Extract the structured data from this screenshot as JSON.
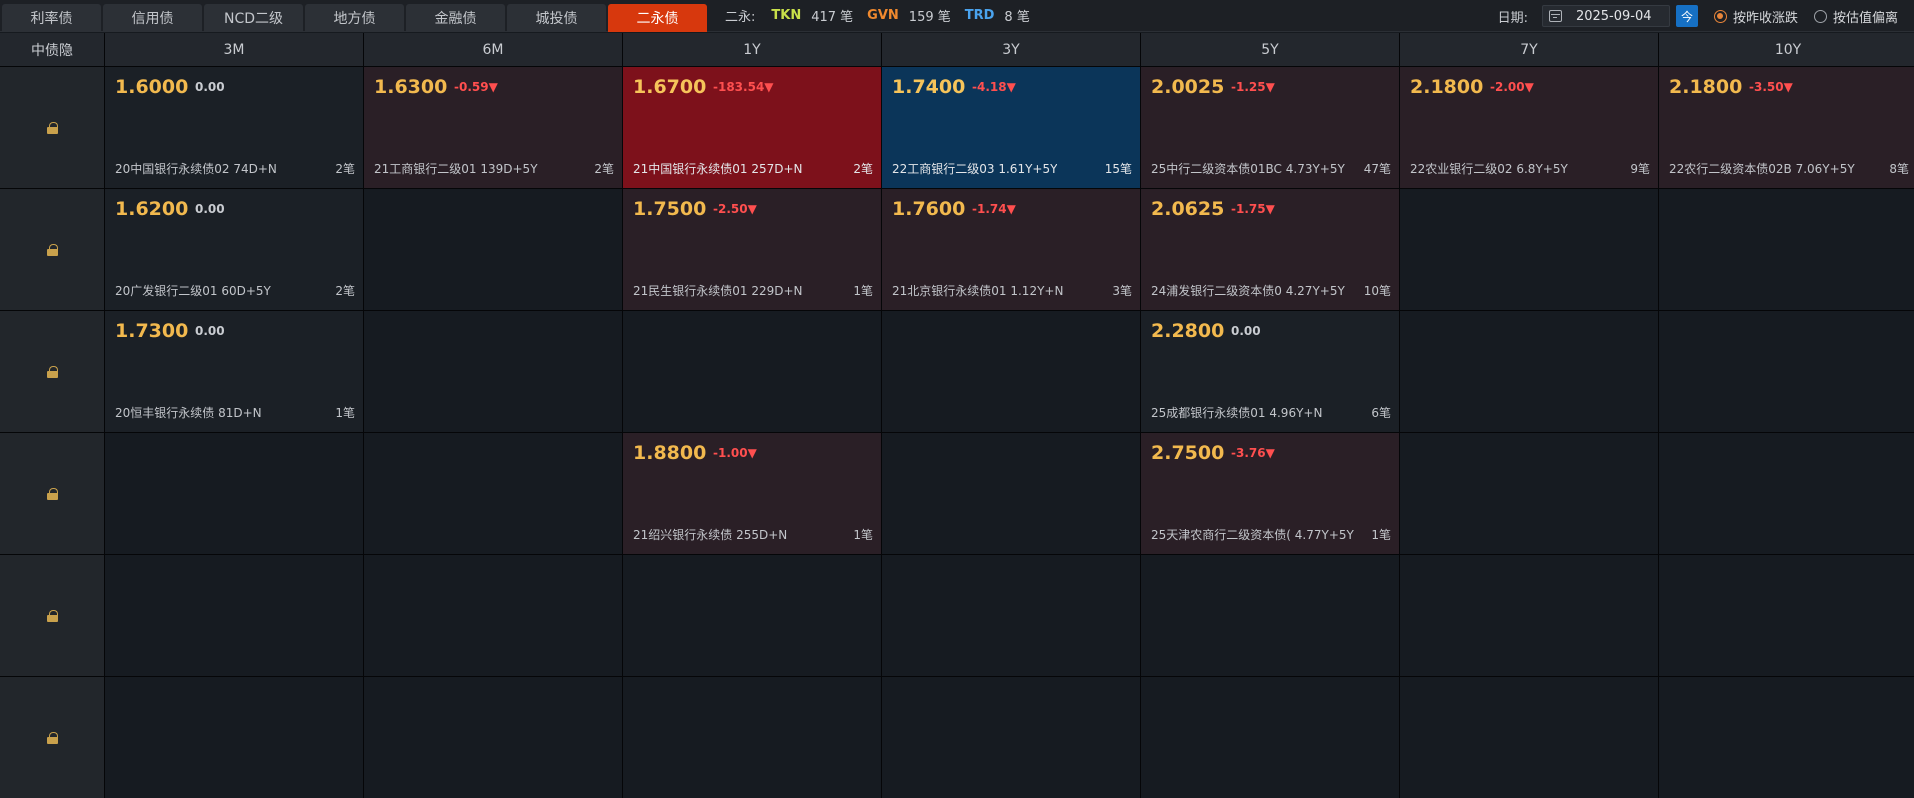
{
  "tabs": [
    {
      "label": "利率债",
      "active": false
    },
    {
      "label": "信用债",
      "active": false
    },
    {
      "label": "NCD二级",
      "active": false
    },
    {
      "label": "地方债",
      "active": false
    },
    {
      "label": "金融债",
      "active": false
    },
    {
      "label": "城投债",
      "active": false
    },
    {
      "label": "二永债",
      "active": true
    }
  ],
  "summary": {
    "label": "二永:",
    "items": [
      {
        "code": "TKN",
        "count": "417 笔",
        "color": "#c8e04a"
      },
      {
        "code": "GVN",
        "count": "159 笔",
        "color": "#f0892e"
      },
      {
        "code": "TRD",
        "count": "8 笔",
        "color": "#4aa3ee"
      }
    ]
  },
  "controls": {
    "date_label": "日期:",
    "date_value": "2025-09-04",
    "today_label": "今",
    "radio_prev_close": "按昨收涨跌",
    "radio_valuation": "按估值偏离",
    "selected": "prev_close"
  },
  "grid": {
    "corner_label": "中债隐",
    "columns": [
      "3M",
      "6M",
      "1Y",
      "3Y",
      "5Y",
      "7Y",
      "10Y"
    ],
    "rows": [
      [
        {
          "yield": "1.6000",
          "change": "0.00",
          "dir": "zero",
          "bond": "20中国银行永续债02 74D+N",
          "count": "2笔",
          "style": "q"
        },
        {
          "yield": "1.6300",
          "change": "-0.59▼",
          "dir": "down",
          "bond": "21工商银行二级01 139D+5Y",
          "count": "2笔",
          "style": "neg"
        },
        {
          "yield": "1.6700",
          "change": "-183.54▼",
          "dir": "down",
          "bond": "21中国银行永续债01 257D+N",
          "count": "2笔",
          "style": "hot"
        },
        {
          "yield": "1.7400",
          "change": "-4.18▼",
          "dir": "down",
          "bond": "22工商银行二级03 1.61Y+5Y",
          "count": "15笔",
          "style": "blue"
        },
        {
          "yield": "2.0025",
          "change": "-1.25▼",
          "dir": "down",
          "bond": "25中行二级资本债01BC 4.73Y+5Y",
          "count": "47笔",
          "style": "neg"
        },
        {
          "yield": "2.1800",
          "change": "-2.00▼",
          "dir": "down",
          "bond": "22农业银行二级02 6.8Y+5Y",
          "count": "9笔",
          "style": "neg"
        },
        {
          "yield": "2.1800",
          "change": "-3.50▼",
          "dir": "down",
          "bond": "22农行二级资本债02B 7.06Y+5Y",
          "count": "8笔",
          "style": "neg"
        }
      ],
      [
        {
          "yield": "1.6200",
          "change": "0.00",
          "dir": "zero",
          "bond": "20广发银行二级01 60D+5Y",
          "count": "2笔",
          "style": "q"
        },
        null,
        {
          "yield": "1.7500",
          "change": "-2.50▼",
          "dir": "down",
          "bond": "21民生银行永续债01 229D+N",
          "count": "1笔",
          "style": "neg"
        },
        {
          "yield": "1.7600",
          "change": "-1.74▼",
          "dir": "down",
          "bond": "21北京银行永续债01 1.12Y+N",
          "count": "3笔",
          "style": "neg"
        },
        {
          "yield": "2.0625",
          "change": "-1.75▼",
          "dir": "down",
          "bond": "24浦发银行二级资本债0 4.27Y+5Y",
          "count": "10笔",
          "style": "neg"
        },
        null,
        null
      ],
      [
        {
          "yield": "1.7300",
          "change": "0.00",
          "dir": "zero",
          "bond": "20恒丰银行永续债 81D+N",
          "count": "1笔",
          "style": "q"
        },
        null,
        null,
        null,
        {
          "yield": "2.2800",
          "change": "0.00",
          "dir": "zero",
          "bond": "25成都银行永续债01 4.96Y+N",
          "count": "6笔",
          "style": "q"
        },
        null,
        null
      ],
      [
        null,
        null,
        {
          "yield": "1.8800",
          "change": "-1.00▼",
          "dir": "down",
          "bond": "21绍兴银行永续债 255D+N",
          "count": "1笔",
          "style": "neg"
        },
        null,
        {
          "yield": "2.7500",
          "change": "-3.76▼",
          "dir": "down",
          "bond": "25天津农商行二级资本债( 4.77Y+5Y",
          "count": "1笔",
          "style": "neg"
        },
        null,
        null
      ],
      [
        null,
        null,
        null,
        null,
        null,
        null,
        null
      ],
      [
        null,
        null,
        null,
        null,
        null,
        null,
        null
      ]
    ]
  }
}
